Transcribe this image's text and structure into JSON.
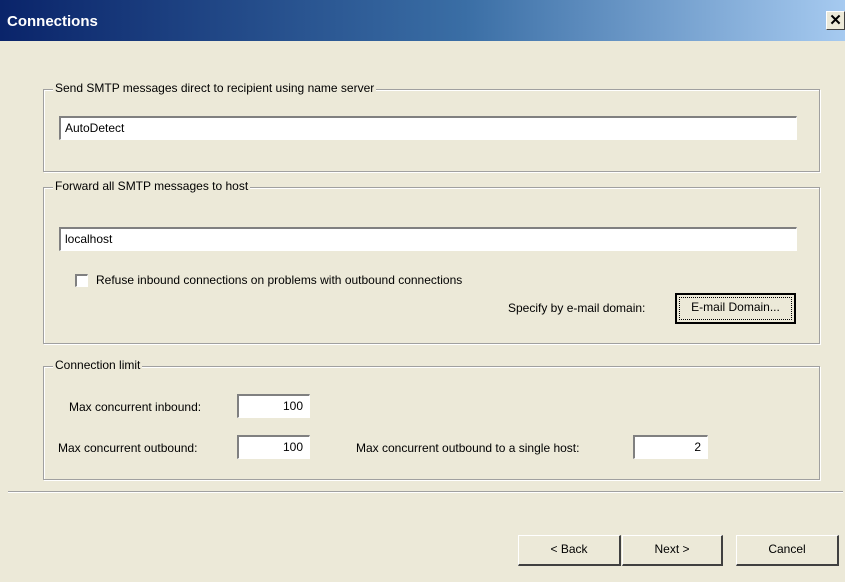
{
  "window": {
    "title": "Connections",
    "close_glyph": "✕",
    "close_icon": "close-icon"
  },
  "smtp_direct": {
    "legend": "Send SMTP messages direct to recipient using name server",
    "name_server": "AutoDetect"
  },
  "smtp_forward": {
    "legend": "Forward all SMTP messages to host",
    "host": "localhost",
    "refuse_checkbox_label": "Refuse inbound connections on problems with outbound connections",
    "refuse_checked": false,
    "specify_label": "Specify by e-mail domain:",
    "email_domain_button": "E-mail Domain..."
  },
  "connection_limit": {
    "legend": "Connection limit",
    "inbound_label": "Max concurrent inbound:",
    "inbound_value": "100",
    "outbound_label": "Max concurrent outbound:",
    "outbound_value": "100",
    "single_host_label": "Max concurrent outbound to a single host:",
    "single_host_value": "2"
  },
  "footer": {
    "back": "< Back",
    "next": "Next >",
    "cancel": "Cancel"
  }
}
